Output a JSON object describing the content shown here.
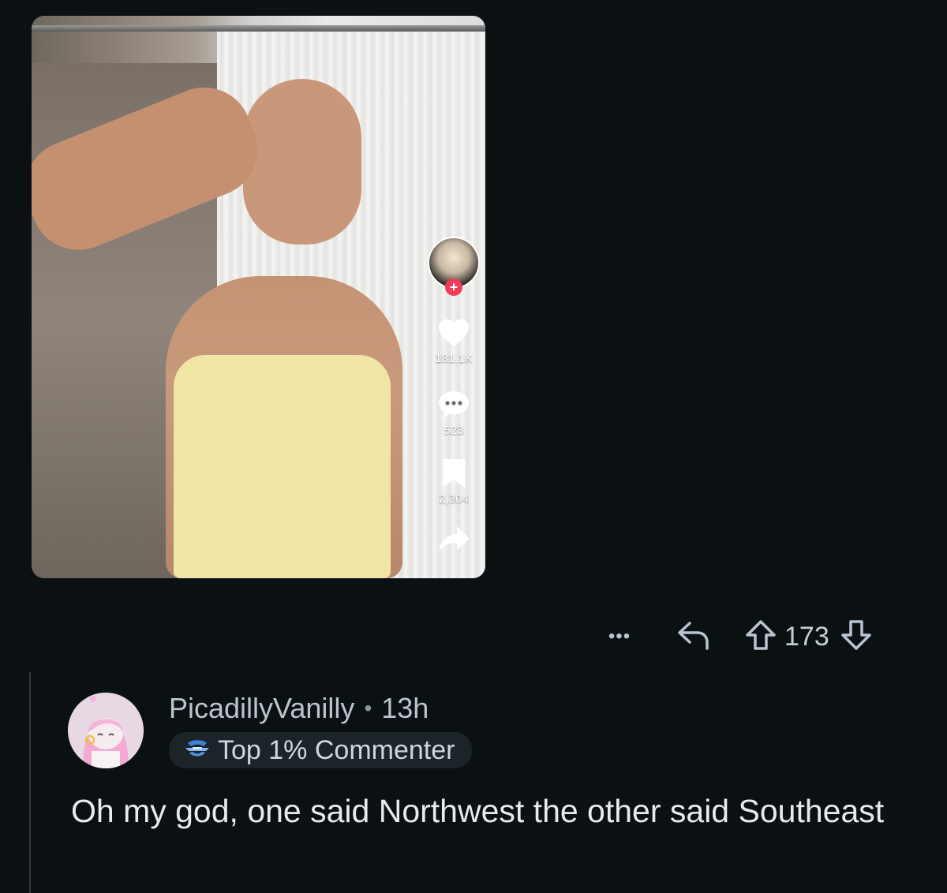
{
  "video": {
    "likes": "181.1K",
    "comments": "523",
    "saves": "2,304",
    "icons": {
      "creator": "creator-avatar",
      "follow": "plus-icon",
      "like": "heart-icon",
      "comment": "comment-bubble-icon",
      "save": "bookmark-icon",
      "share": "share-arrow-icon"
    }
  },
  "post_actions": {
    "more_label": "•••",
    "score": "173",
    "icons": {
      "reply": "reply-arrow-icon",
      "upvote": "upvote-arrow-icon",
      "downvote": "downvote-arrow-icon"
    }
  },
  "comment": {
    "username": "PicadillyVanilly",
    "separator": "•",
    "age": "13h",
    "flair": "Top 1% Commenter",
    "body": "Oh my god, one said Northwest the other said Southeast"
  },
  "colors": {
    "background": "#0b1013",
    "meta_text": "#b9c6ce",
    "body_text": "#e8ebed",
    "flair_bg": "#1d2429",
    "tiktok_red": "#ef3b57"
  }
}
